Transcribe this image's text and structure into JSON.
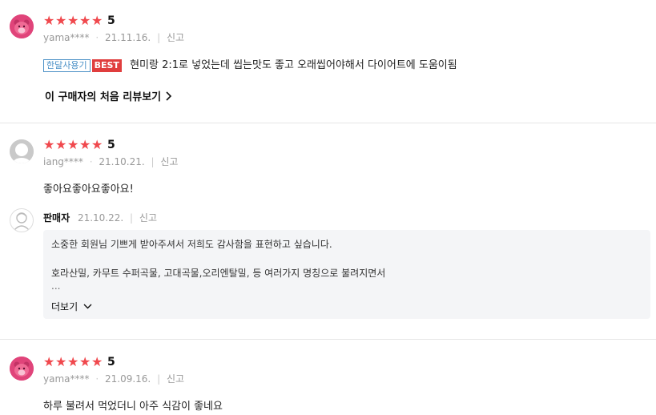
{
  "reviews": [
    {
      "score": "5",
      "user": "yama****",
      "date": "21.11.16.",
      "report": "신고",
      "tag_month": "한달사용기",
      "tag_best": "BEST",
      "text": "현미랑  2:1로  넣었는데  씹는맛도 좋고  오래씹어야해서 다이어트에 도움이됨",
      "first_review_link": "이 구매자의 처음 리뷰보기"
    },
    {
      "score": "5",
      "user": "iang****",
      "date": "21.10.21.",
      "report": "신고",
      "text": "좋아요좋아요좋아요!",
      "seller_reply": {
        "name": "판매자",
        "date": "21.10.22.",
        "report": "신고",
        "line1": "소중한 회원님 기쁘게 받아주셔서 저희도 감사함을 표현하고 싶습니다.",
        "line2": "호라산밀, 카무트 수퍼곡물, 고대곡물,오리엔탈밀, 등  여러가지 명칭으로 불려지면서",
        "ellipsis": "...",
        "more_label": "더보기"
      }
    },
    {
      "score": "5",
      "user": "yama****",
      "date": "21.09.16.",
      "report": "신고",
      "text": "하루 불려서 먹었더니  아주 식감이 좋네요"
    }
  ],
  "icons": {
    "star": "★",
    "chevron_right": "chevron-right-icon",
    "chevron_down": "chevron-down-icon"
  },
  "colors": {
    "star": "#f0484d",
    "best_tag": "#e03e3e",
    "month_tag": "#4a90c6",
    "avatar_pink": "#e0447a",
    "seller_box_bg": "#f4f5f7"
  }
}
